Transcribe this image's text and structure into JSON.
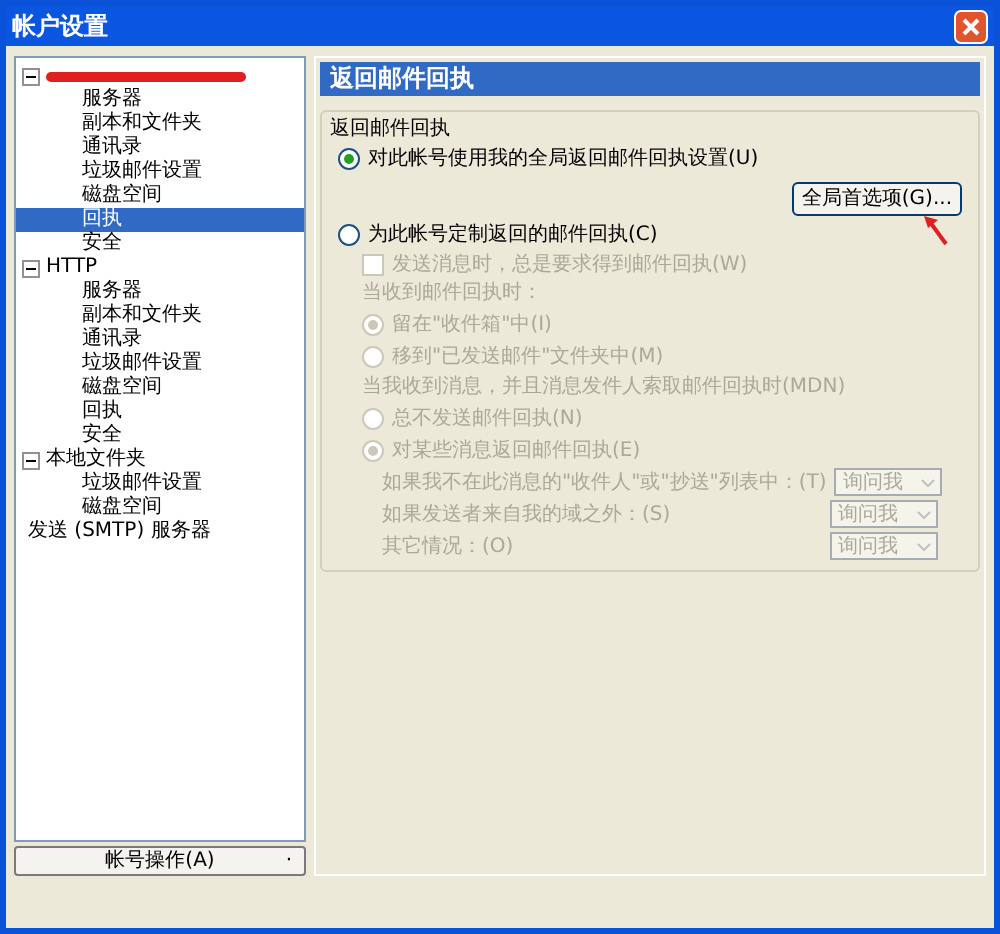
{
  "window": {
    "title": "帐户设置"
  },
  "tree": [
    {
      "redacted": true,
      "expanded": true,
      "selected": false,
      "children": [
        {
          "label": "服务器",
          "selected": false
        },
        {
          "label": "副本和文件夹",
          "selected": false
        },
        {
          "label": "通讯录",
          "selected": false
        },
        {
          "label": "垃圾邮件设置",
          "selected": false
        },
        {
          "label": "磁盘空间",
          "selected": false
        },
        {
          "label": "回执",
          "selected": true
        },
        {
          "label": "安全",
          "selected": false
        }
      ]
    },
    {
      "label": "HTTP",
      "redacted": false,
      "expanded": true,
      "selected": false,
      "children": [
        {
          "label": "服务器",
          "selected": false
        },
        {
          "label": "副本和文件夹",
          "selected": false
        },
        {
          "label": "通讯录",
          "selected": false
        },
        {
          "label": "垃圾邮件设置",
          "selected": false
        },
        {
          "label": "磁盘空间",
          "selected": false
        },
        {
          "label": "回执",
          "selected": false
        },
        {
          "label": "安全",
          "selected": false
        }
      ]
    },
    {
      "label": "本地文件夹",
      "redacted": false,
      "expanded": true,
      "selected": false,
      "children": [
        {
          "label": "垃圾邮件设置",
          "selected": false
        },
        {
          "label": "磁盘空间",
          "selected": false
        }
      ]
    },
    {
      "label": "发送 (SMTP) 服务器",
      "redacted": false,
      "selected": false
    }
  ],
  "account_actions_button": {
    "label": "帐号操作(A)",
    "caret": "·"
  },
  "panel": {
    "header": "返回邮件回执",
    "group_label": "返回邮件回执",
    "options": [
      {
        "kind": "radio",
        "label": "对此帐号使用我的全局返回邮件回执设置(U)",
        "selected": true,
        "disabled": false
      },
      {
        "kind": "button",
        "label": "全局首选项(G)...",
        "annotated": true
      },
      {
        "kind": "radio",
        "label": "为此帐号定制返回的邮件回执(C)",
        "selected": false,
        "disabled": false,
        "children": [
          {
            "kind": "checkbox",
            "label": "发送消息时，总是要求得到邮件回执(W)",
            "checked": false,
            "disabled": true
          },
          {
            "kind": "label",
            "label": "当收到邮件回执时：",
            "disabled": true
          },
          {
            "kind": "radio",
            "label": "留在\"收件箱\"中(I)",
            "selected": true,
            "disabled": true
          },
          {
            "kind": "radio",
            "label": "移到\"已发送邮件\"文件夹中(M)",
            "selected": false,
            "disabled": true
          },
          {
            "kind": "label",
            "label": "当我收到消息，并且消息发件人索取邮件回执时(MDN)",
            "disabled": true
          },
          {
            "kind": "radio",
            "label": "总不发送邮件回执(N)",
            "selected": false,
            "disabled": true
          },
          {
            "kind": "radio",
            "label": "对某些消息返回邮件回执(E)",
            "selected": true,
            "disabled": true,
            "children": [
              {
                "kind": "select",
                "label": "如果我不在此消息的\"收件人\"或\"抄送\"列表中：(T)",
                "value": "询问我",
                "disabled": true
              },
              {
                "kind": "select",
                "label": "如果发送者来自我的域之外：(S)",
                "value": "询问我",
                "disabled": true
              },
              {
                "kind": "select",
                "label": "其它情况：(O)",
                "value": "询问我",
                "disabled": true
              }
            ]
          }
        ]
      }
    ]
  }
}
